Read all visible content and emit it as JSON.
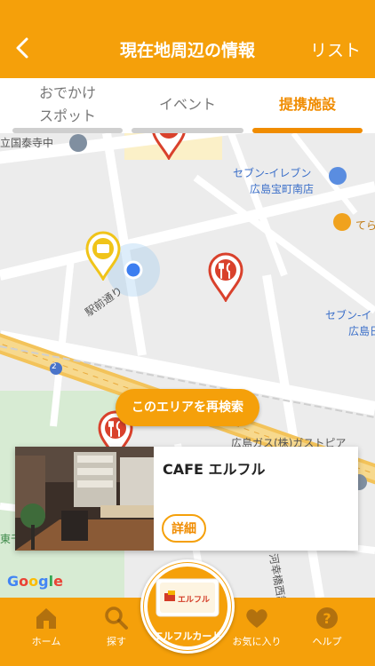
{
  "header": {
    "back_icon": "chevron-left-icon",
    "title": "現在地周辺の情報",
    "list_label": "リスト"
  },
  "tabs": [
    {
      "label_line1": "おでかけ",
      "label_line2": "スポット"
    },
    {
      "label_line1": "イベント"
    },
    {
      "label_line1": "提携施設"
    }
  ],
  "map": {
    "labels": {
      "school": "立国泰寺中",
      "seven1_line1": "セブン-イレブン",
      "seven1_line2": "広島宝町南店",
      "tera": "てら",
      "seven2_line1": "セブン-イ",
      "seven2_line2": "広島日",
      "ekimae": "駅前通り",
      "gas": "広島ガス(株)ガストピア",
      "higashi": "東千",
      "kogo": "河幸橋西詰",
      "route": "2"
    },
    "search_area_label": "このエリアを再検索",
    "google": "Google"
  },
  "card": {
    "name": "CAFE エルフル",
    "detail_label": "詳細"
  },
  "footer": {
    "items": [
      {
        "label": "ホーム",
        "icon": "home-icon"
      },
      {
        "label": "探す",
        "icon": "search-icon"
      },
      {
        "label": "お気に入り",
        "icon": "heart-icon"
      },
      {
        "label": "ヘルプ",
        "icon": "help-icon"
      }
    ],
    "center_label": "エルフルカード",
    "card_logo_text": "エルフル"
  },
  "colors": {
    "accent": "#f5a00a",
    "accent_dark": "#f08c00",
    "pin_red": "#d9412c",
    "pin_yellow": "#f0c419"
  }
}
